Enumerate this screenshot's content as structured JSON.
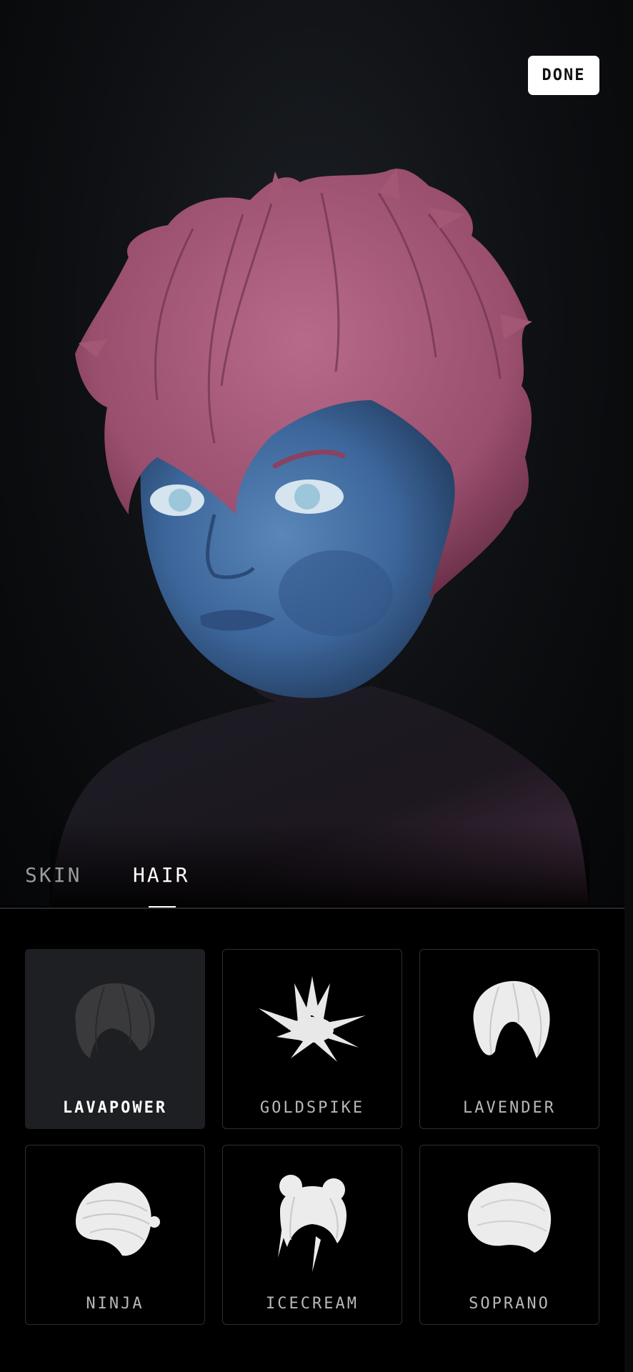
{
  "header": {
    "done_label": "DONE"
  },
  "tabs": [
    {
      "label": "SKIN",
      "active": false
    },
    {
      "label": "HAIR",
      "active": true
    }
  ],
  "hair_options": [
    {
      "label": "LAVAPOWER",
      "icon": "lavapower-hair-icon",
      "selected": true
    },
    {
      "label": "GOLDSPIKE",
      "icon": "goldspike-hair-icon",
      "selected": false
    },
    {
      "label": "LAVENDER",
      "icon": "lavender-hair-icon",
      "selected": false
    },
    {
      "label": "NINJA",
      "icon": "ninja-hair-icon",
      "selected": false
    },
    {
      "label": "ICECREAM",
      "icon": "icecream-hair-icon",
      "selected": false
    },
    {
      "label": "SOPRANO",
      "icon": "soprano-hair-icon",
      "selected": false
    }
  ],
  "colors": {
    "skin": "#3f6aa0",
    "hair": "#a35775",
    "background": "#000000",
    "button": "#ffffff"
  }
}
